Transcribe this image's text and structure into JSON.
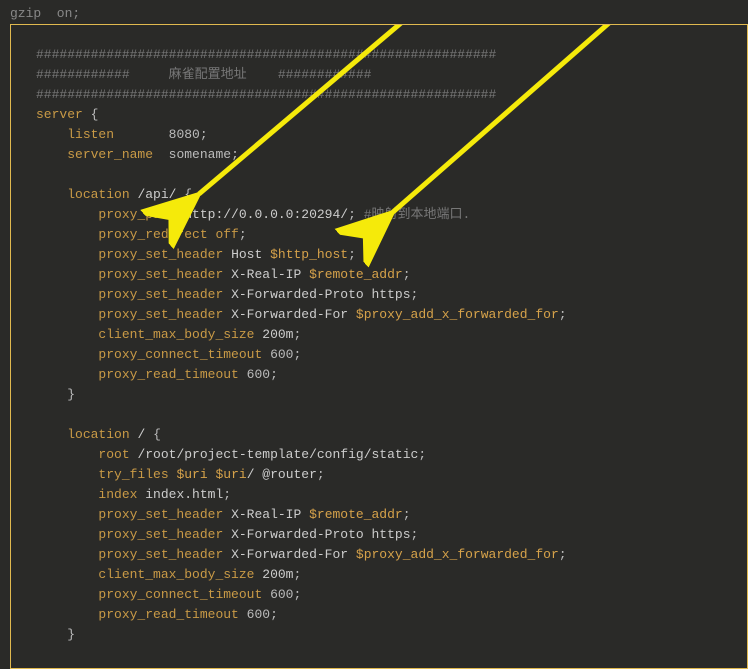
{
  "code": {
    "top_fragment": "gzip  on;",
    "comment1": "###########################################################",
    "comment2": "############     麻雀配置地址    ############",
    "comment3": "###########################################################",
    "server_kw": "server",
    "brace_open": "{",
    "listen_kw": "listen",
    "listen_val": "8080",
    "semi": ";",
    "servername_kw": "server_name",
    "servername_val": "somename",
    "location_kw": "location",
    "loc1_path": "/api/",
    "proxypass_kw": "proxy_pass",
    "proxypass_val": "http://0.0.0.0:20294/",
    "proxypass_comment": "#映射到本地端口.",
    "proxyredirect_kw": "proxy_redirect",
    "off_kw": "off",
    "psh_kw": "proxy_set_header",
    "host_label": "Host",
    "http_host_var": "$http_host",
    "xrealip_label": "X-Real-IP",
    "remoteaddr_var": "$remote_addr",
    "xfproto_label": "X-Forwarded-Proto",
    "https_val": "https",
    "xffor_label": "X-Forwarded-For",
    "pafwd_var": "$proxy_add_x_forwarded_for",
    "cmbs_kw": "client_max_body_size",
    "cmbs_val": "200m",
    "pct_kw": "proxy_connect_timeout",
    "pct_val": "600",
    "prt_kw": "proxy_read_timeout",
    "prt_val": "600",
    "brace_close": "}",
    "loc2_path": "/",
    "root_kw": "root",
    "root_val": "/root/project-template/config/static",
    "tryfiles_kw": "try_files",
    "uri_var": "$uri",
    "tryfiles_tail": "/ @router",
    "index_kw": "index",
    "index_val": "index.html"
  }
}
